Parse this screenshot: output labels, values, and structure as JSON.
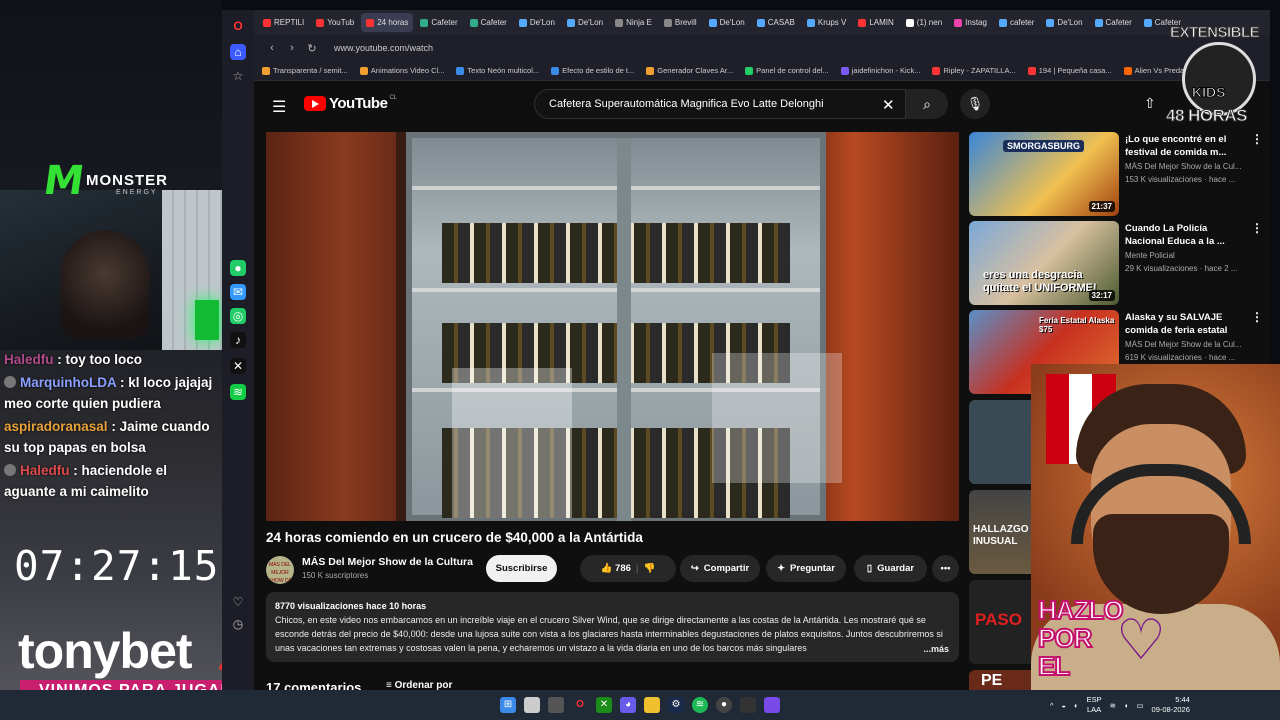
{
  "browser": {
    "tabs": [
      "REPTILI",
      "YouTub",
      "24 horas",
      "Cafeter",
      "Cafeter",
      "De'Lon",
      "De'Lon",
      "Ninja E",
      "Brevill",
      "De'Lon",
      "CASAB",
      "Krups V",
      "LAMIN",
      "(1) nen",
      "Instag",
      "cafeter",
      "De'Lon",
      "Cafeter",
      "Cafeter"
    ],
    "active_tab": "24 horas",
    "url": "www.youtube.com/watch",
    "bookmarks": [
      "Transparenta / semit...",
      "Animations Video Cl...",
      "Texto Neón multicol...",
      "Efecto de estilo de t...",
      "Generador Claves Ar...",
      "Panel de control del...",
      "jaidefinichon - Kick...",
      "Ripley - ZAPATILLA...",
      "194 | Pequeña casa...",
      "Alien Vs Predato"
    ]
  },
  "youtube": {
    "logo": "YouTube",
    "logo_country": "CL",
    "search_value": "Cafetera Superautomática Magnifica Evo Latte Delonghi",
    "video": {
      "title": "24 horas comiendo en un crucero de $40,000 a la Antártida",
      "channel": "MÁS Del Mejor Show de la Cultura",
      "channel_avatar_text": "MÁS DEL MEJOR SHOW DE LA CULTURA",
      "subscribers": "150 K suscriptores",
      "subscribe_label": "Suscribirse",
      "likes": "786",
      "share_label": "Compartir",
      "ask_label": "Preguntar",
      "save_label": "Guardar",
      "views_meta": "8770 visualizaciones  hace 10 horas",
      "description": "Chicos, en este video nos embarcamos en un increíble viaje en el crucero Silver Wind, que se dirige directamente a las costas de la Antártida. Les mostraré qué se esconde detrás del precio de $40,000: desde una lujosa suite con vista a los glaciares hasta interminables degustaciones de platos exquisitos. Juntos descubriremos si unas vacaciones tan extremas y costosas valen la pena, y echaremos un vistazo a la vida diaria en uno de los barcos más singulares",
      "more_label": "...más",
      "comments_header": "17 comentarios",
      "sort_label": "Ordenar por"
    },
    "recommendations": [
      {
        "title": "¡Lo que encontré en el festival de comida m...",
        "channel": "MÁS Del Mejor Show de la Cul...",
        "views": "153 K visualizaciones · hace ...",
        "duration": "21:37",
        "thumb_text": "SMORGASBURG"
      },
      {
        "title": "Cuando La Policía Nacional Educa a la ...",
        "channel": "Mente Policial",
        "views": "29 K visualizaciones · hace 2 ...",
        "duration": "32:17",
        "thumb_text": "eres una desgracia quítate el UNIFORME!"
      },
      {
        "title": "Alaska y su SALVAJE comida de feria estatal",
        "channel": "MÁS Del Mejor Show de la Cul...",
        "views": "619 K visualizaciones · hace ...",
        "duration": "",
        "thumb_text": "Feria Estatal Alaska $75"
      }
    ],
    "partial_thumbs": [
      "HALLAZGO INUSUAL",
      "PASO",
      "PE"
    ]
  },
  "stream": {
    "sponsor_top": "MONSTER",
    "sponsor_top_sub": "ENERGY",
    "chat": [
      {
        "user": "Haledfu",
        "text": ": toy too loco",
        "color": "#b04a8b"
      },
      {
        "user": "MarquinhoLDA",
        "text": ": kl loco jajajaj meo corte quien pudiera",
        "color": "#8aa0ff"
      },
      {
        "user": "aspiradoranasal",
        "text": ": Jaime cuando su top papas en bolsa",
        "color": "#e7a23a"
      },
      {
        "user": "Haledfu",
        "text": ": haciendole el aguante a mi caimelito",
        "color": "#e04a4a"
      }
    ],
    "clock": "07:27:15",
    "sponsor_bottom": "tonybet",
    "sponsor_banner": "VINIMOS PARA JUGAR",
    "top_right_logo_line1": "EXTENSIBLE",
    "top_right_logo_kids": "KIDS",
    "top_right_logo_line2": "48 HORAS",
    "overlay_text": "HAZLO POR EL"
  },
  "taskbar": {
    "lang": "ESP",
    "lang2": "LAA",
    "time": "5:44",
    "date": "09-08-2026"
  },
  "colors": {
    "youtube_red": "#ff0000",
    "subscribe_bg": "#f1f1f1",
    "tonybet_banner": "#c91f6f"
  }
}
